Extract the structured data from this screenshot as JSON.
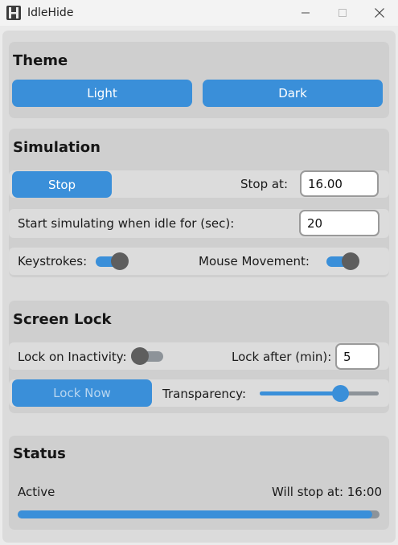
{
  "window": {
    "title": "IdleHide",
    "icon": "server-rack-icon"
  },
  "theme": {
    "title": "Theme",
    "light_label": "Light",
    "dark_label": "Dark"
  },
  "simulation": {
    "title": "Simulation",
    "stop_label": "Stop",
    "stop_at_label": "Stop at:",
    "stop_at_value": "16.00",
    "idle_label": "Start simulating when idle for (sec):",
    "idle_value": "20",
    "keystrokes_label": "Keystrokes:",
    "keystrokes_enabled": true,
    "mouse_label": "Mouse Movement:",
    "mouse_enabled": true
  },
  "screen_lock": {
    "title": "Screen Lock",
    "lock_inactivity_label": "Lock on Inactivity:",
    "lock_inactivity_enabled": false,
    "lock_after_label": "Lock after (min):",
    "lock_after_value": "5",
    "lock_now_label": "Lock Now",
    "transparency_label": "Transparency:",
    "transparency_level": 0.71
  },
  "status": {
    "title": "Status",
    "state": "Active",
    "stop_info": "Will stop at: 16:00",
    "progress": 0.98
  },
  "colors": {
    "accent": "#3a8fd9",
    "card_bg": "#cfcfcf",
    "row_bg": "#dcdcdc",
    "track_off": "#8d9399",
    "knob": "#5e5e5e"
  }
}
